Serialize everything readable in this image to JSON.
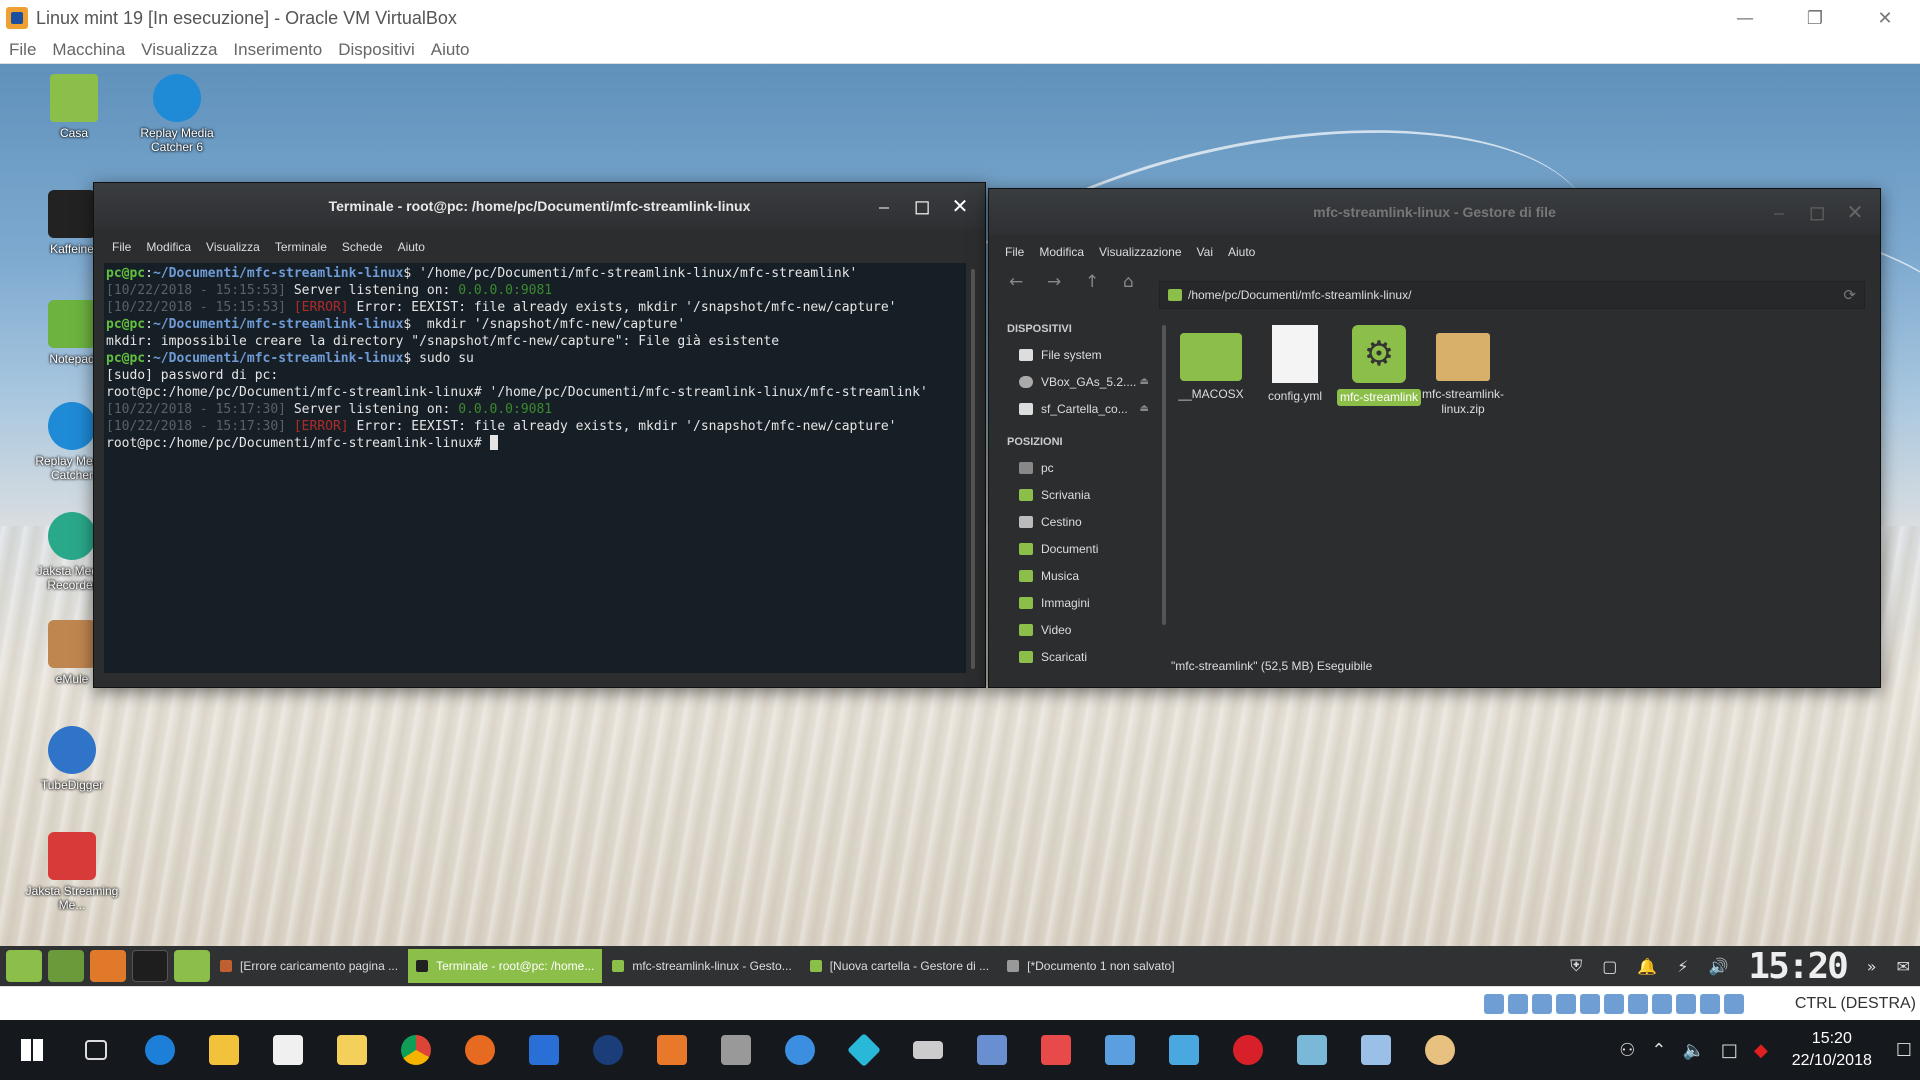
{
  "vbox": {
    "title": "Linux mint 19 [In esecuzione] - Oracle VM VirtualBox",
    "menu": [
      "File",
      "Macchina",
      "Visualizza",
      "Inserimento",
      "Dispositivi",
      "Aiuto"
    ],
    "status_key": "CTRL (DESTRA)"
  },
  "desktop_icons": [
    {
      "label": "Casa",
      "icon": "home-folder-icon"
    },
    {
      "label": "Replay Media Catcher 6",
      "icon": "replay-media-catcher-icon"
    },
    {
      "label": "Kaffeine",
      "icon": "kaffeine-icon"
    },
    {
      "label": "Notepad",
      "icon": "notepad-icon"
    },
    {
      "label": "Replay Media Catcher",
      "icon": "replay-media-catcher-icon"
    },
    {
      "label": "Jaksta Media Recorder",
      "icon": "jaksta-recorder-icon"
    },
    {
      "label": "eMule",
      "icon": "emule-icon"
    },
    {
      "label": "TubeDigger",
      "icon": "tubedigger-icon"
    },
    {
      "label": "Jaksta Streaming Me...",
      "icon": "jaksta-streaming-icon"
    }
  ],
  "terminal": {
    "title": "Terminale - root@pc: /home/pc/Documenti/mfc-streamlink-linux",
    "menu": [
      "File",
      "Modifica",
      "Visualizza",
      "Terminale",
      "Schede",
      "Aiuto"
    ],
    "lines": {
      "l1_user": "pc@pc",
      "l1_path": "~/Documenti/mfc-streamlink-linux",
      "l1_cmd": "$ '/home/pc/Documenti/mfc-streamlink-linux/mfc-streamlink'",
      "l2_ts": "[10/22/2018 - 15:15:53]",
      "l2_msg": " Server listening on: ",
      "l2_addr": "0.0.0.0:9081",
      "l3_ts": "[10/22/2018 - 15:15:53]",
      "l3_err": " [ERROR]",
      "l3_msg": " Error: EEXIST: file already exists, mkdir '/snapshot/mfc-new/capture'",
      "l4_user": "pc@pc",
      "l4_path": "~/Documenti/mfc-streamlink-linux",
      "l4_cmd": "$  mkdir '/snapshot/mfc-new/capture'",
      "l5": "mkdir: impossibile creare la directory \"/snapshot/mfc-new/capture\": File già esistente",
      "l6_user": "pc@pc",
      "l6_path": "~/Documenti/mfc-streamlink-linux",
      "l6_cmd": "$ sudo su",
      "l7": "[sudo] password di pc:",
      "l8": "root@pc:/home/pc/Documenti/mfc-streamlink-linux# '/home/pc/Documenti/mfc-streamlink-linux/mfc-streamlink'",
      "l9_ts": "[10/22/2018 - 15:17:30]",
      "l9_msg": " Server listening on: ",
      "l9_addr": "0.0.0.0:9081",
      "l10_ts": "[10/22/2018 - 15:17:30]",
      "l10_err": " [ERROR]",
      "l10_msg": " Error: EEXIST: file already exists, mkdir '/snapshot/mfc-new/capture'",
      "l11": "root@pc:/home/pc/Documenti/mfc-streamlink-linux# "
    }
  },
  "filemanager": {
    "title": "mfc-streamlink-linux - Gestore di file",
    "menu": [
      "File",
      "Modifica",
      "Visualizzazione",
      "Vai",
      "Aiuto"
    ],
    "path": "/home/pc/Documenti/mfc-streamlink-linux/",
    "devices_header": "DISPOSITIVI",
    "devices": [
      "File system",
      "VBox_GAs_5.2....",
      "sf_Cartella_co..."
    ],
    "places_header": "POSIZIONI",
    "places": [
      "pc",
      "Scrivania",
      "Cestino",
      "Documenti",
      "Musica",
      "Immagini",
      "Video",
      "Scaricati"
    ],
    "files": [
      {
        "name": "__MACOSX",
        "kind": "folder"
      },
      {
        "name": "config.yml",
        "kind": "text"
      },
      {
        "name": "mfc-streamlink",
        "kind": "executable",
        "selected": true
      },
      {
        "name": "mfc-streamlink-linux.zip",
        "kind": "archive"
      }
    ],
    "status": "\"mfc-streamlink\" (52,5 MB) Eseguibile"
  },
  "mint_panel": {
    "tasks": [
      "[Errore caricamento pagina ...",
      "Terminale - root@pc: /home...",
      "mfc-streamlink-linux - Gesto...",
      "[Nuova cartella - Gestore di ...",
      "[*Documento 1 non salvato]"
    ],
    "clock": "15:20"
  },
  "windows_taskbar": {
    "time": "15:20",
    "date": "22/10/2018"
  },
  "colors": {
    "mint_accent": "#8cbf4a",
    "terminal_bg": "#161e26",
    "taskbar_bg": "#15181c"
  }
}
